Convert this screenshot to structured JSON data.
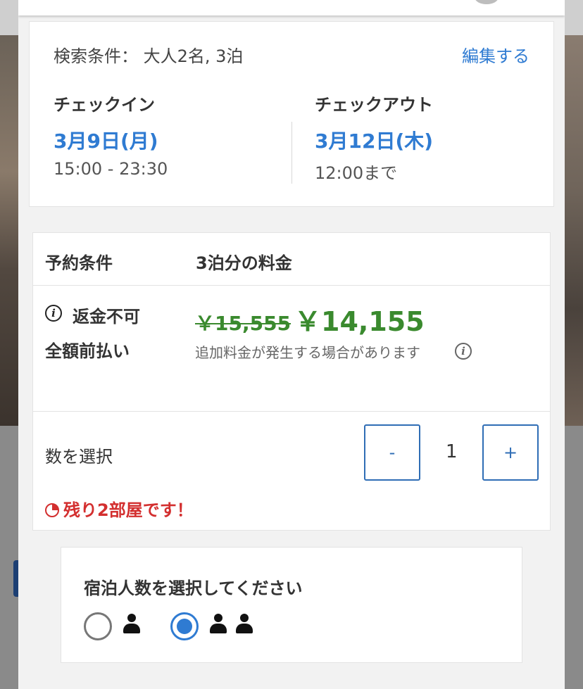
{
  "search": {
    "label": "検索条件：",
    "value": "大人2名, 3泊",
    "edit_label": "編集する"
  },
  "checkin": {
    "label": "チェックイン",
    "date": "3月9日(月)",
    "time": "15:00 - 23:30"
  },
  "checkout": {
    "label": "チェックアウト",
    "date": "3月12日(木)",
    "time": "12:00まで"
  },
  "rate": {
    "header_left": "予約条件",
    "header_right": "3泊分の料金",
    "policy_line1": "返金不可",
    "policy_line2": "全額前払い",
    "old_price": "￥15,555",
    "new_price": "￥14,155",
    "extra_note": "追加料金が発生する場合があります",
    "qty_label": "数を選択",
    "minus_label": "-",
    "qty_value": "1",
    "plus_label": "+",
    "remaining": "残り2部屋です！"
  },
  "guests": {
    "title": "宿泊人数を選択してください",
    "options": [
      {
        "persons": 1,
        "selected": false
      },
      {
        "persons": 2,
        "selected": true
      }
    ]
  },
  "colors": {
    "link_blue": "#2f7bd2",
    "price_green": "#3a8a2e",
    "alert_red": "#d32f2f"
  }
}
